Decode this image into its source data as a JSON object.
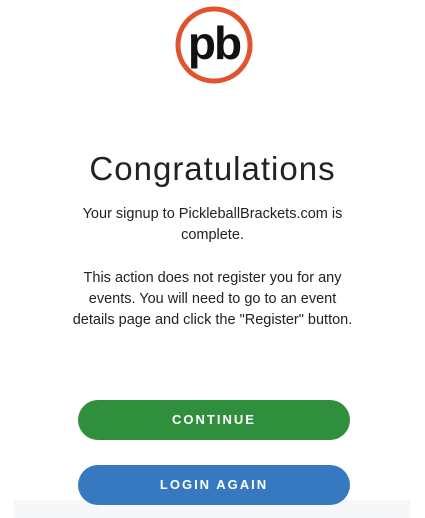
{
  "brand": {
    "logo_text": "pb",
    "logo_ring_color": "#e0532e",
    "logo_letter_color": "#111111"
  },
  "main": {
    "title": "Congratulations",
    "message_line1": "Your signup to PickleballBrackets.com is complete.",
    "message_line2": "This action does not register you for any events. You will need to go to an event details page and click the \"Register\" button."
  },
  "actions": {
    "continue_label": "CONTINUE",
    "continue_color": "#2f8f3c",
    "login_label": "LOGIN AGAIN",
    "login_color": "#3679c0"
  }
}
